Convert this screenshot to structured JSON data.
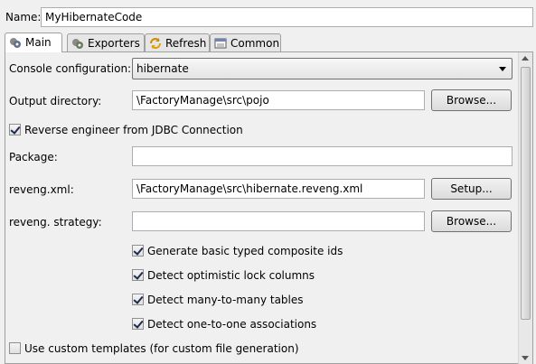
{
  "name_field": {
    "label": "Name:",
    "value": "MyHibernateCode"
  },
  "tabs": [
    {
      "label": "Main",
      "icon": "main-icon",
      "active": true
    },
    {
      "label": "Exporters",
      "icon": "exporters-icon",
      "active": false
    },
    {
      "label": "Refresh",
      "icon": "refresh-icon",
      "active": false
    },
    {
      "label": "Common",
      "icon": "common-icon",
      "active": false
    }
  ],
  "main": {
    "console_configuration": {
      "label": "Console configuration:",
      "value": "hibernate"
    },
    "output_directory": {
      "label": "Output directory:",
      "value": "\\FactoryManage\\src\\pojo",
      "button": "Browse..."
    },
    "reverse_engineer": {
      "label": "Reverse engineer from JDBC Connection",
      "checked": true
    },
    "package": {
      "label": "Package:",
      "value": ""
    },
    "reveng_xml": {
      "label": "reveng.xml:",
      "value": "\\FactoryManage\\src\\hibernate.reveng.xml",
      "button": "Setup..."
    },
    "reveng_strategy": {
      "label": "reveng. strategy:",
      "value": "",
      "button": "Browse..."
    },
    "options": [
      {
        "label": "Generate basic typed composite ids",
        "checked": true
      },
      {
        "label": "Detect optimistic lock columns",
        "checked": true
      },
      {
        "label": "Detect many-to-many tables",
        "checked": true
      },
      {
        "label": "Detect one-to-one associations",
        "checked": true
      }
    ],
    "custom_templates": {
      "label": "Use custom templates (for custom file generation)",
      "checked": false
    }
  }
}
